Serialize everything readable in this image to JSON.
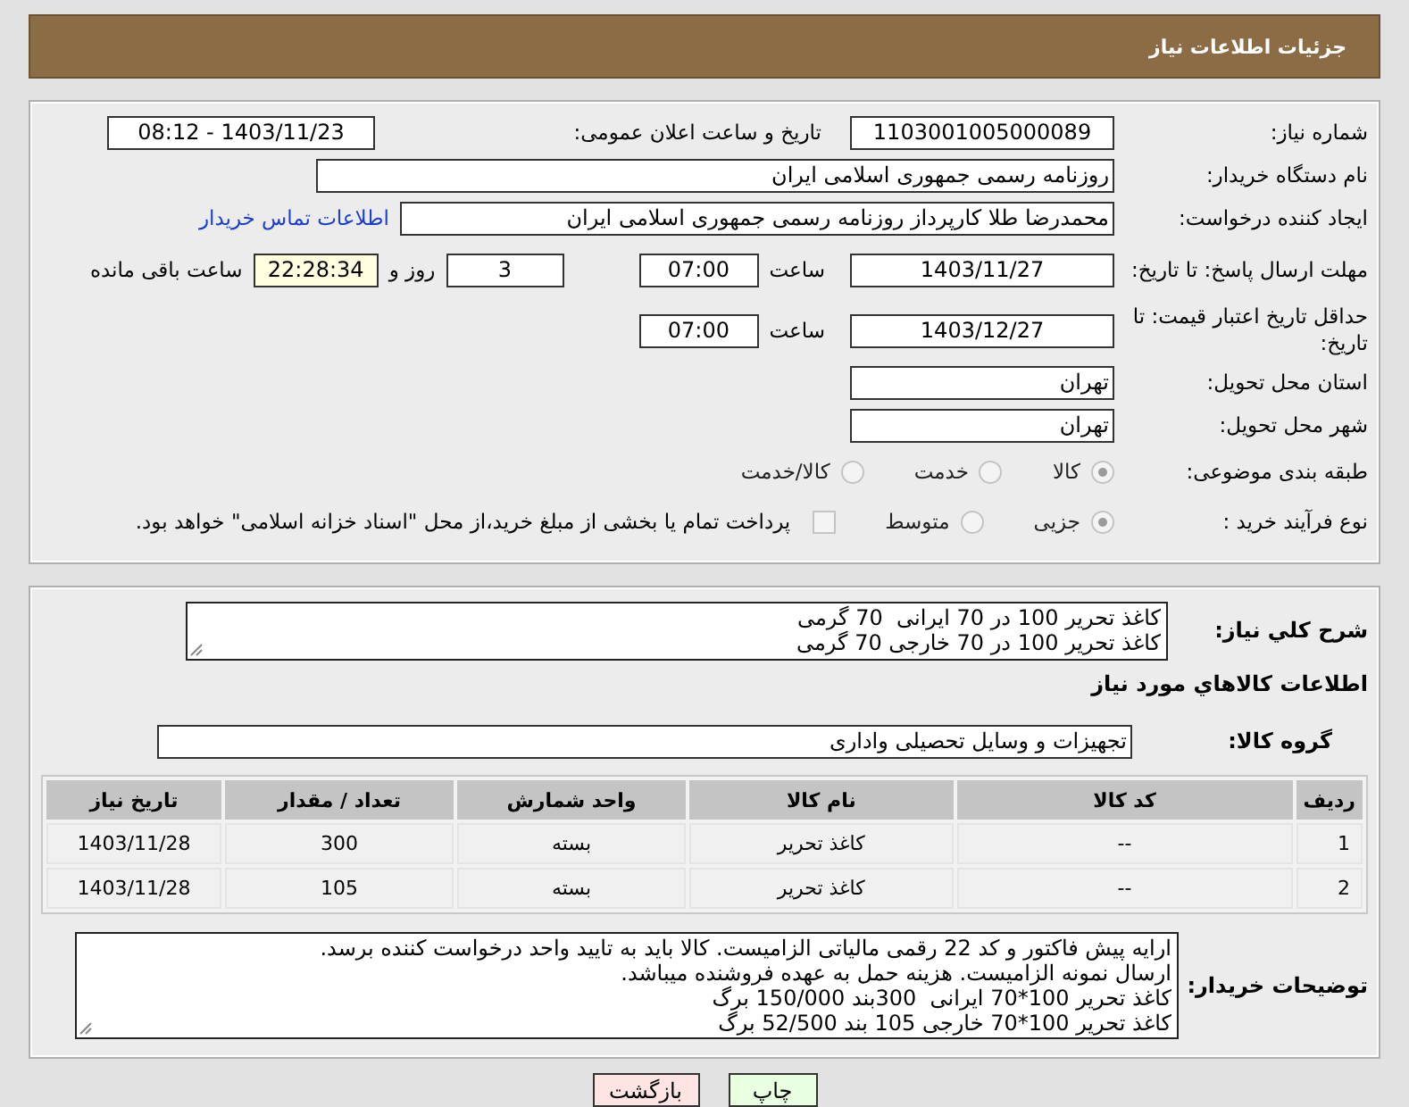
{
  "header": {
    "title": "جزئیات اطلاعات نیاز"
  },
  "need_number": {
    "label": "شماره نیاز:",
    "value": "1103001005000089"
  },
  "announce": {
    "label": "تاریخ و ساعت اعلان عمومی:",
    "value": "1403/11/23 - 08:12"
  },
  "buyer_org": {
    "label": "نام دستگاه خریدار:",
    "value": "روزنامه رسمی جمهوری اسلامی ایران"
  },
  "requester": {
    "label": "ایجاد کننده درخواست:",
    "value": "محمدرضا طلا کارپرداز روزنامه رسمی جمهوری اسلامی ایران",
    "link": "اطلاعات تماس خریدار"
  },
  "deadline": {
    "label": "مهلت ارسال پاسخ: تا تاریخ:",
    "date": "1403/11/27",
    "time_label": "ساعت",
    "time": "07:00",
    "days": "3",
    "days_label": "روز و",
    "remaining": "22:28:34",
    "remaining_label": "ساعت باقی مانده"
  },
  "validity": {
    "label": "حداقل تاریخ اعتبار قیمت: تا تاریخ:",
    "date": "1403/12/27",
    "time_label": "ساعت",
    "time": "07:00"
  },
  "province": {
    "label": "استان محل تحویل:",
    "value": "تهران"
  },
  "city": {
    "label": "شهر محل تحویل:",
    "value": "تهران"
  },
  "category": {
    "label": "طبقه بندی موضوعی:",
    "options": [
      {
        "label": "کالا",
        "selected": true
      },
      {
        "label": "خدمت",
        "selected": false
      },
      {
        "label": "کالا/خدمت",
        "selected": false
      }
    ]
  },
  "process": {
    "label": "نوع فرآیند خرید :",
    "options": [
      {
        "label": "جزیی",
        "selected": true
      },
      {
        "label": "متوسط",
        "selected": false
      }
    ],
    "treasury": {
      "checked": false,
      "label": "پرداخت تمام یا بخشی از مبلغ خرید،از محل \"اسناد خزانه اسلامی\" خواهد بود."
    }
  },
  "description": {
    "label": "شرح کلي نياز:",
    "lines": [
      "کاغذ تحریر 100 در 70 ایرانی  70 گرمی",
      "کاغذ تحریر 100 در 70 خارجی 70 گرمی"
    ]
  },
  "items_title": "اطلاعات کالاهاي مورد نياز",
  "group": {
    "label": "گروه کالا:",
    "value": "تجهیزات و وسایل تحصیلی واداری"
  },
  "table": {
    "columns": [
      "رديف",
      "کد کالا",
      "نام کالا",
      "واحد شمارش",
      "تعداد / مقدار",
      "تاريخ نياز"
    ],
    "rows": [
      [
        "1",
        "--",
        "کاغذ تحریر",
        "بسته",
        "300",
        "1403/11/28"
      ],
      [
        "2",
        "--",
        "کاغذ تحریر",
        "بسته",
        "105",
        "1403/11/28"
      ]
    ]
  },
  "buyer_notes": {
    "label": "توضیحات خریدار:",
    "lines": [
      "ارایه پیش فاکتور و کد 22 رقمی مالیاتی الزامیست. کالا باید به تایید واحد درخواست کننده برسد.",
      "ارسال نمونه الزامیست. هزینه حمل به عهده فروشنده میباشد.",
      "کاغذ تحریر 100*70 ایرانی  300بند 150/000 برگ",
      "کاغذ تحریر 100*70 خارجی 105 بند 52/500 برگ"
    ]
  },
  "buttons": [
    {
      "label": "چاپ",
      "kind": "print"
    },
    {
      "label": "بازگشت",
      "kind": "back"
    }
  ]
}
